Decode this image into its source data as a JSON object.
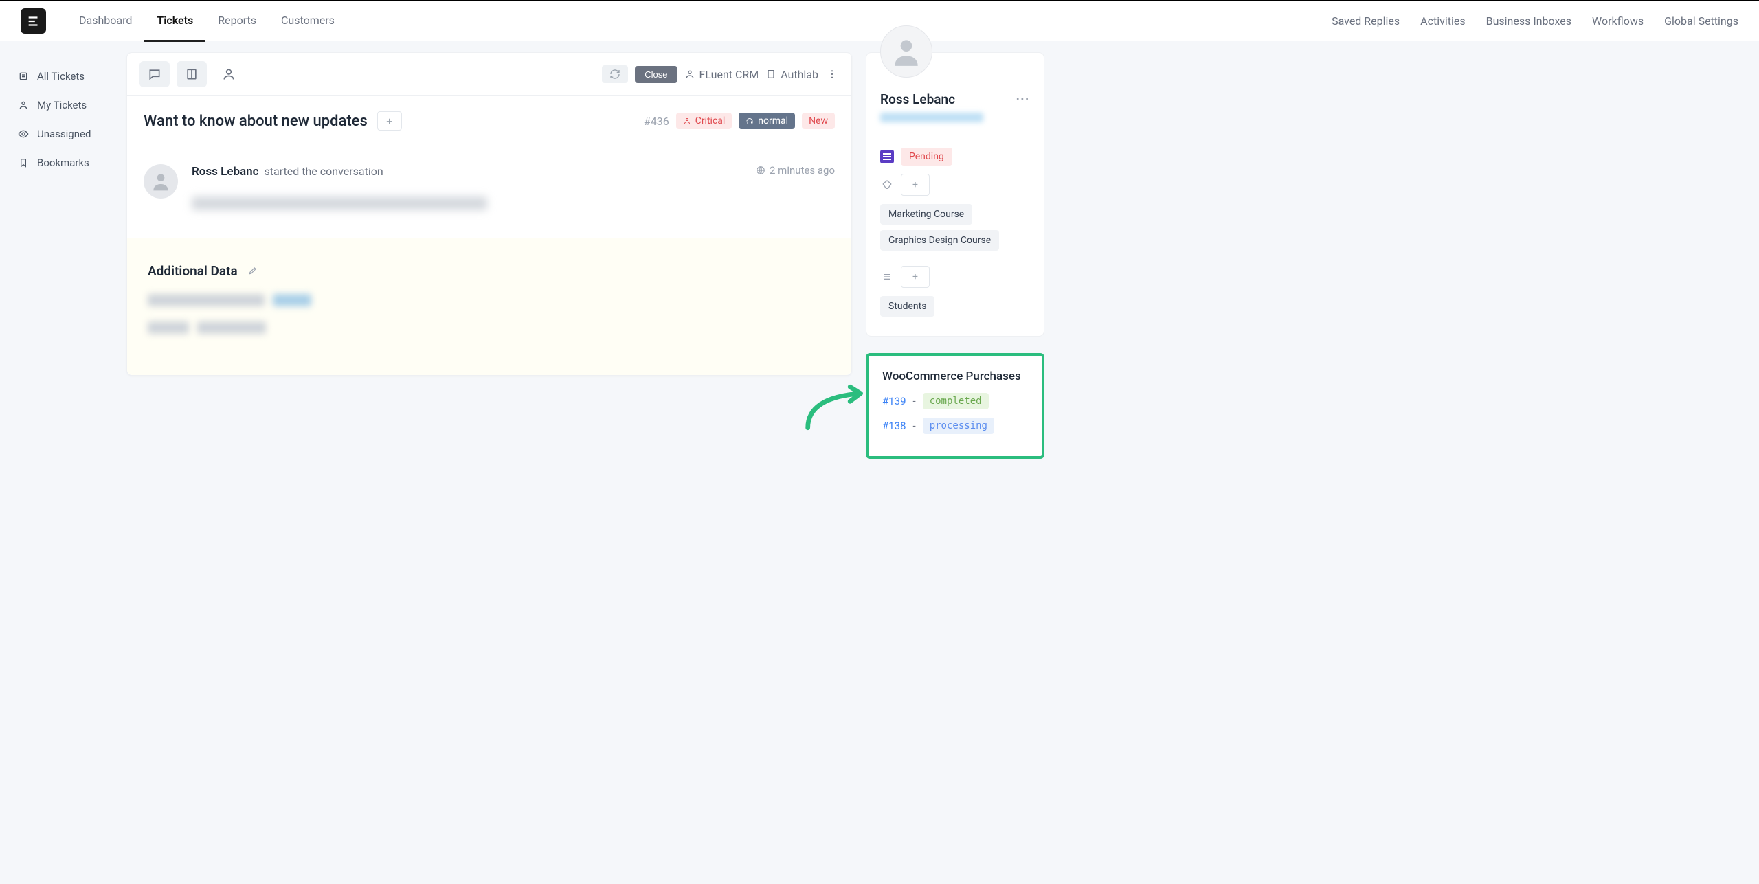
{
  "nav": {
    "left": [
      "Dashboard",
      "Tickets",
      "Reports",
      "Customers"
    ],
    "active": "Tickets",
    "right": [
      "Saved Replies",
      "Activities",
      "Business Inboxes",
      "Workflows",
      "Global Settings"
    ]
  },
  "sidebar": {
    "items": [
      {
        "label": "All Tickets",
        "icon": "ticket"
      },
      {
        "label": "My Tickets",
        "icon": "user"
      },
      {
        "label": "Unassigned",
        "icon": "eye"
      },
      {
        "label": "Bookmarks",
        "icon": "bookmark"
      }
    ]
  },
  "toolbar": {
    "close_label": "Close",
    "link_a": "FLuent CRM",
    "link_b": "Authlab"
  },
  "ticket": {
    "title": "Want to know about new updates",
    "id": "#436",
    "priority": "Critical",
    "channel": "normal",
    "status": "New"
  },
  "conversation": {
    "author": "Ross Lebanc",
    "subtext": "started the conversation",
    "time": "2 minutes ago"
  },
  "additional": {
    "heading": "Additional Data"
  },
  "profile": {
    "name": "Ross Lebanc",
    "status": "Pending",
    "tags": [
      "Marketing Course",
      "Graphics Design Course"
    ],
    "lists": [
      "Students"
    ]
  },
  "woo": {
    "title": "WooCommerce Purchases",
    "orders": [
      {
        "id": "#139",
        "status": "completed",
        "status_class": "completed"
      },
      {
        "id": "#138",
        "status": "processing",
        "status_class": "processing"
      }
    ]
  }
}
